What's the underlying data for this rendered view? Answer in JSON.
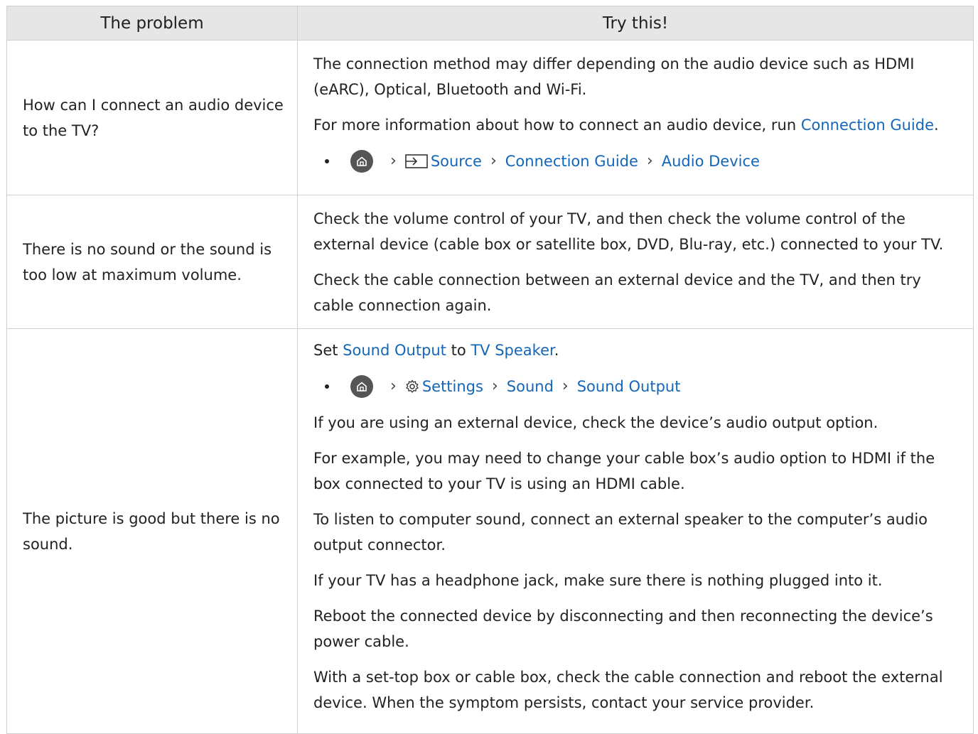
{
  "header": {
    "col1": "The problem",
    "col2": "Try this!"
  },
  "rows": [
    {
      "problem": "How can I connect an audio device to the TV?",
      "p1": "The connection method may differ depending on the audio device such as HDMI (eARC), Optical, Bluetooth and Wi-Fi.",
      "p2_before": "For more information about how to connect an audio device, run ",
      "p2_link": "Connection Guide",
      "p2_after": ".",
      "path": {
        "icon1": "home-icon",
        "icon2": "source-icon",
        "step1": "Source",
        "step2": "Connection Guide",
        "step3": "Audio Device"
      }
    },
    {
      "problem": "There is no sound or the sound is too low at maximum volume.",
      "p1": "Check the volume control of your TV, and then check the volume control of the external device (cable box or satellite box, DVD, Blu-ray, etc.) connected to your TV.",
      "p2": "Check the cable connection between an external device and the TV, and then try cable connection again."
    },
    {
      "problem": "The picture is good but there is no sound.",
      "p1_set": "Set ",
      "p1_link1": "Sound Output",
      "p1_to": " to ",
      "p1_link2": "TV Speaker",
      "p1_end": ".",
      "path": {
        "icon1": "home-icon",
        "icon2": "settings-icon",
        "step1": "Settings",
        "step2": "Sound",
        "step3": "Sound Output"
      },
      "p2": "If you are using an external device, check the device’s audio output option.",
      "p3": "For example, you may need to change your cable box’s audio option to HDMI if the box connected to your TV is using an HDMI cable.",
      "p4": "To listen to computer sound, connect an external speaker to the computer’s audio output connector.",
      "p5": "If your TV has a headphone jack, make sure there is nothing plugged into it.",
      "p6": "Reboot the connected device by disconnecting and then reconnecting the device’s power cable.",
      "p7": "With a set-top box or cable box, check the cable connection and reboot the external device. When the symptom persists, contact your service provider."
    }
  ],
  "colors": {
    "link": "#1466b8",
    "header_bg": "#e6e6e6",
    "border": "#cfcfcf",
    "text": "#222222"
  }
}
